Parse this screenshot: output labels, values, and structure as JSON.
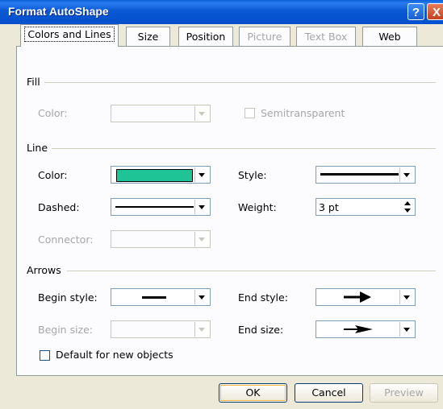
{
  "window": {
    "title": "Format AutoShape",
    "help_glyph": "?",
    "close_glyph": "X"
  },
  "tabs": [
    {
      "label": "Colors and Lines",
      "active": true,
      "enabled": true
    },
    {
      "label": "Size",
      "active": false,
      "enabled": true
    },
    {
      "label": "Position",
      "active": false,
      "enabled": true
    },
    {
      "label": "Picture",
      "active": false,
      "enabled": false
    },
    {
      "label": "Text Box",
      "active": false,
      "enabled": false
    },
    {
      "label": "Web",
      "active": false,
      "enabled": true
    }
  ],
  "fill": {
    "group_label": "Fill",
    "color_label": "Color:",
    "semitransparent_label": "Semitransparent",
    "semitransparent_checked": false
  },
  "line": {
    "group_label": "Line",
    "color_label": "Color:",
    "color_value": "#1fc496",
    "dashed_label": "Dashed:",
    "connector_label": "Connector:",
    "style_label": "Style:",
    "weight_label": "Weight:",
    "weight_value": "3 pt"
  },
  "arrows": {
    "group_label": "Arrows",
    "begin_style_label": "Begin style:",
    "begin_size_label": "Begin size:",
    "end_style_label": "End style:",
    "end_size_label": "End size:"
  },
  "default_checkbox": {
    "label": "Default for new objects",
    "checked": false
  },
  "buttons": {
    "ok": "OK",
    "cancel": "Cancel",
    "preview": "Preview"
  }
}
